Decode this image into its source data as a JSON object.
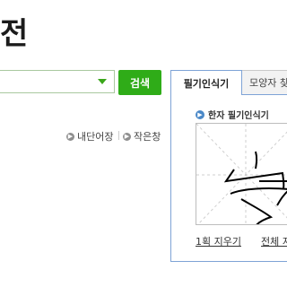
{
  "page": {
    "title": "전"
  },
  "search": {
    "value": "",
    "button_label": "검색"
  },
  "util_links": {
    "notebook": "내단어장",
    "small_window": "작은창"
  },
  "hanja_panel": {
    "tabs": [
      {
        "label": "필기인식기",
        "active": true
      },
      {
        "label": "모양자 찾",
        "active": false
      }
    ],
    "header": "한자 필기인식기",
    "actions": {
      "clear_one": "1획 지우기",
      "clear_all": "전체 지"
    }
  },
  "colors": {
    "search_button": "#2fac18",
    "panel_border": "#7ea3d6",
    "stroke": "#000000"
  }
}
